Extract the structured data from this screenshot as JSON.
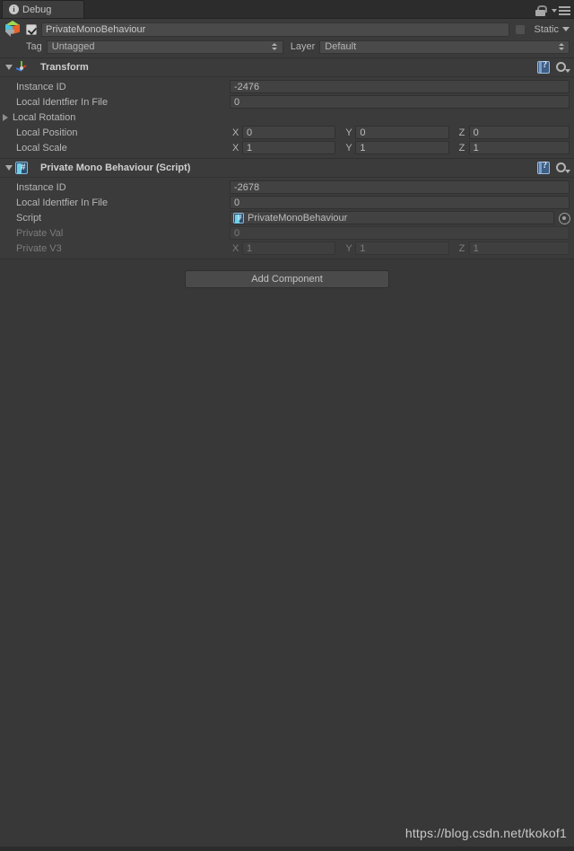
{
  "window": {
    "tab_label": "Debug",
    "tab_icon": "info-icon",
    "lock_icon": "lock-icon",
    "menu_icon": "hamburger-menu-icon"
  },
  "gameobject": {
    "icon": "prefab-cube-icon",
    "enabled_checkbox": true,
    "name": "PrivateMonoBehaviour",
    "static_label": "Static",
    "static_checked": false,
    "tag_label": "Tag",
    "tag_value": "Untagged",
    "layer_label": "Layer",
    "layer_value": "Default"
  },
  "components": [
    {
      "icon": "transform-axis-icon",
      "title": "Transform",
      "expanded": true,
      "help_icon": "help-book-icon",
      "settings_icon": "gear-icon",
      "rows": [
        {
          "type": "text",
          "label": "Instance ID",
          "value": "-2476",
          "disabled": false
        },
        {
          "type": "text",
          "label": "Local Identfier In File",
          "value": "0",
          "disabled": false
        },
        {
          "type": "foldout",
          "label": "Local Rotation",
          "disabled": false
        },
        {
          "type": "vector3",
          "label": "Local Position",
          "x_label": "X",
          "y_label": "Y",
          "z_label": "Z",
          "x": "0",
          "y": "0",
          "z": "0",
          "disabled": false
        },
        {
          "type": "vector3",
          "label": "Local Scale",
          "x_label": "X",
          "y_label": "Y",
          "z_label": "Z",
          "x": "1",
          "y": "1",
          "z": "1",
          "disabled": false
        }
      ]
    },
    {
      "icon": "csharp-script-icon",
      "title": "Private Mono Behaviour (Script)",
      "expanded": true,
      "help_icon": "help-book-icon",
      "settings_icon": "gear-icon",
      "rows": [
        {
          "type": "text",
          "label": "Instance ID",
          "value": "-2678",
          "disabled": false
        },
        {
          "type": "text",
          "label": "Local Identfier In File",
          "value": "0",
          "disabled": false
        },
        {
          "type": "object",
          "label": "Script",
          "value": "PrivateMonoBehaviour",
          "object_icon": "csharp-script-icon",
          "picker_icon": "object-picker-icon",
          "disabled": false
        },
        {
          "type": "text",
          "label": "Private Val",
          "value": "0",
          "disabled": true
        },
        {
          "type": "vector3",
          "label": "Private V3",
          "x_label": "X",
          "y_label": "Y",
          "z_label": "Z",
          "x": "1",
          "y": "1",
          "z": "1",
          "disabled": true
        }
      ]
    }
  ],
  "add_component": {
    "label": "Add Component"
  },
  "watermark": {
    "text": "https://blog.csdn.net/tkokof1"
  },
  "colors": {
    "background": "#383838",
    "panel": "#3b3b3b",
    "field": "#424242",
    "text": "#b6b6b6",
    "text_disabled": "#7c7c7c",
    "axis_x": "#d03a2e",
    "axis_y": "#6fc52c",
    "axis_z": "#3a7fe0"
  }
}
